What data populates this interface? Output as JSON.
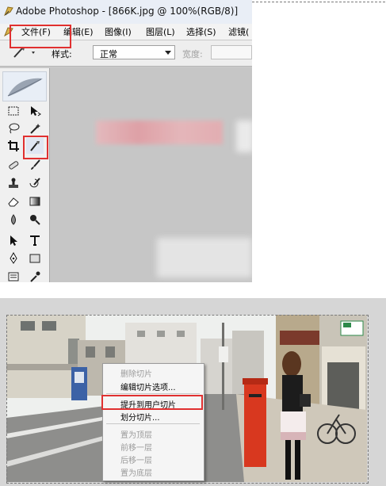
{
  "window": {
    "title": "Adobe Photoshop - [866K.jpg @ 100%(RGB/8)]"
  },
  "menubar": {
    "items": [
      "文件(F)",
      "编辑(E)",
      "图像(I)",
      "图层(L)",
      "选择(S)",
      "滤镜("
    ]
  },
  "options_bar": {
    "style_label": "样式:",
    "style_value": "正常",
    "width_label": "宽度:"
  },
  "toolbox": {
    "tools": [
      "marquee-tool",
      "move-tool",
      "lasso-tool",
      "magic-wand-tool",
      "crop-tool",
      "slice-tool",
      "healing-brush-tool",
      "brush-tool",
      "clone-stamp-tool",
      "history-brush-tool",
      "eraser-tool",
      "gradient-tool",
      "blur-tool",
      "dodge-tool",
      "path-selection-tool",
      "type-tool",
      "pen-tool",
      "shape-tool",
      "notes-tool",
      "eyedropper-tool"
    ],
    "highlighted_tool": "slice-select-tool"
  },
  "context_menu": {
    "items": [
      {
        "label": "删除切片",
        "enabled": false
      },
      {
        "label": "编辑切片选项...",
        "enabled": true
      },
      {
        "label": "提升到用户切片",
        "enabled": true,
        "highlighted": true
      },
      {
        "label": "划分切片...",
        "enabled": true
      },
      {
        "label": "置为顶层",
        "enabled": false
      },
      {
        "label": "前移一层",
        "enabled": false
      },
      {
        "label": "后移一层",
        "enabled": false
      },
      {
        "label": "置为底层",
        "enabled": false
      }
    ]
  },
  "colors": {
    "highlight_red": "#e03030",
    "titlebar_bg": "#e9eef6",
    "canvas_gray": "#c6c6c6"
  }
}
